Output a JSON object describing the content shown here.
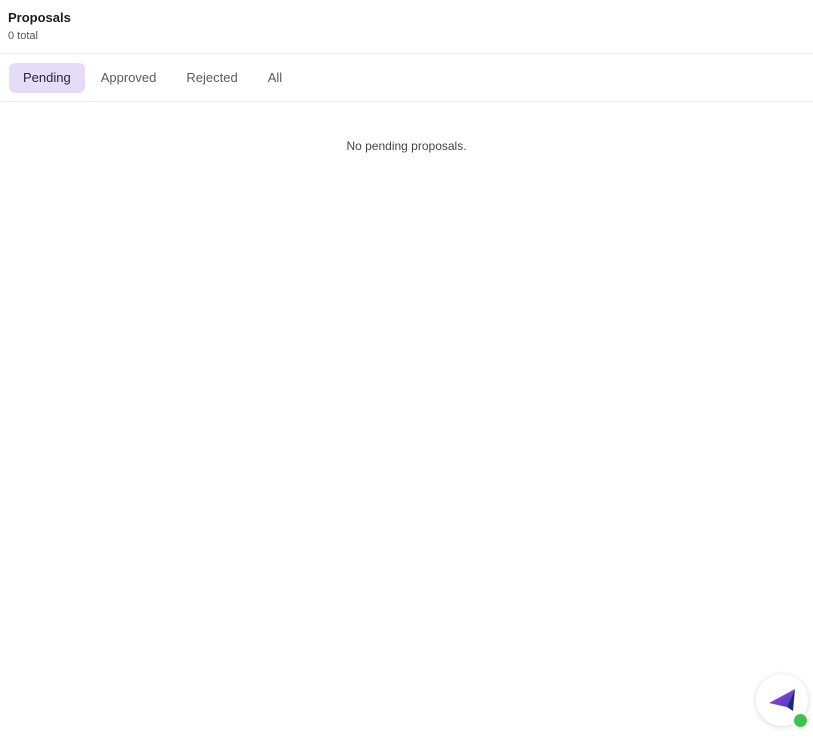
{
  "header": {
    "title": "Proposals",
    "count_text": "0 total"
  },
  "tabs": [
    {
      "label": "Pending",
      "active": true
    },
    {
      "label": "Approved",
      "active": false
    },
    {
      "label": "Rejected",
      "active": false
    },
    {
      "label": "All",
      "active": false
    }
  ],
  "main": {
    "empty_message": "No pending proposals."
  },
  "assistant_button": {
    "icon": "paper-plane-icon",
    "status": "online",
    "status_color": "#3dc24a"
  },
  "colors": {
    "active_tab_bg": "#e6dcfa",
    "divider": "#ececef"
  }
}
